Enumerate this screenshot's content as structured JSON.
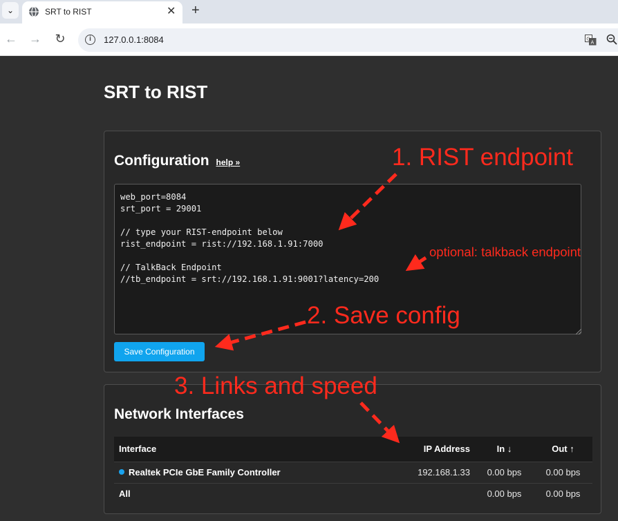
{
  "browser": {
    "tab_title": "SRT to RIST",
    "url": "127.0.0.1:8084"
  },
  "page": {
    "title": "SRT to RIST"
  },
  "configuration": {
    "heading": "Configuration",
    "help_link": "help »",
    "config_text": "web_port=8084\nsrt_port = 29001\n\n// type your RIST-endpoint below\nrist_endpoint = rist://192.168.1.91:7000\n\n// TalkBack Endpoint\n//tb_endpoint = srt://192.168.1.91:9001?latency=200",
    "save_button": "Save Configuration"
  },
  "network": {
    "heading": "Network Interfaces",
    "columns": {
      "interface": "Interface",
      "ip": "IP Address",
      "in": "In ↓",
      "out": "Out ↑"
    },
    "rows": [
      {
        "interface": "Realtek PCIe GbE Family Controller",
        "ip": "192.168.1.33",
        "in": "0.00 bps",
        "out": "0.00 bps"
      },
      {
        "interface": "All",
        "ip": "",
        "in": "0.00 bps",
        "out": "0.00 bps"
      }
    ]
  },
  "annotations": {
    "rist_endpoint": "1. RIST endpoint",
    "talkback": "optional: talkback endpoint",
    "save_config": "2. Save config",
    "links_speed": "3. Links and speed"
  },
  "colors": {
    "page_background": "#2f2f2f",
    "card_background": "#282828",
    "button_accent": "#10a4ee",
    "annotation": "#ff2a1d",
    "status_dot": "#1aa3ee"
  }
}
